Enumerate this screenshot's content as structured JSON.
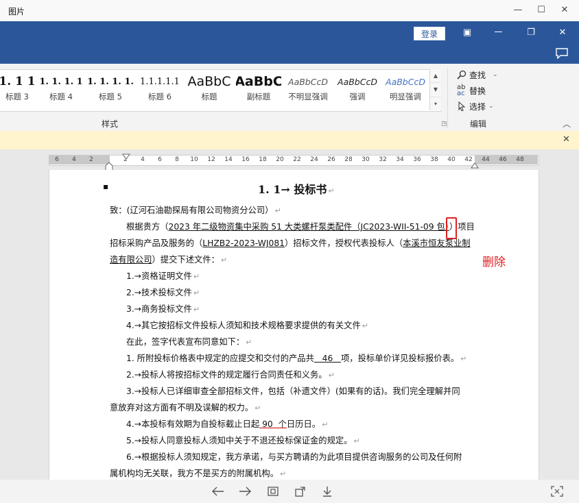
{
  "viewer": {
    "title": "图片",
    "controls": {
      "minimize": "—",
      "maximize": "☐",
      "close": "✕"
    }
  },
  "word": {
    "login": "登录",
    "window_controls": {
      "ribbon_display": "▣",
      "restore": "❐",
      "close": "✕"
    }
  },
  "ribbon": {
    "styles": [
      {
        "sample": "1. 1  1",
        "label": "标题 3"
      },
      {
        "sample": "1. 1. 1. 1",
        "label": "标题 4"
      },
      {
        "sample": "1. 1. 1. 1.",
        "label": "标题 5"
      },
      {
        "sample": "1.1.1.1.1",
        "label": "标题 6"
      },
      {
        "sample": "AaBbC",
        "label": "标题"
      },
      {
        "sample": "AaBbC",
        "label": "副标题"
      },
      {
        "sample": "AaBbCcD",
        "label": "不明显强调"
      },
      {
        "sample": "AaBbCcD",
        "label": "强调"
      },
      {
        "sample": "AaBbCcD",
        "label": "明显强调"
      }
    ],
    "styles_group_label": "样式",
    "editing": {
      "find": "查找",
      "replace": "替换",
      "select": "选择",
      "group_label": "编辑"
    }
  },
  "ruler": {
    "ticks": [
      "6",
      "4",
      "2",
      "",
      "2",
      "4",
      "6",
      "8",
      "10",
      "12",
      "14",
      "16",
      "18",
      "20",
      "22",
      "24",
      "26",
      "28",
      "30",
      "32",
      "34",
      "36",
      "38",
      "40",
      "42",
      "44",
      "46",
      "48"
    ]
  },
  "document": {
    "title": "1. 1→ 投标书",
    "to_line": "致：(辽河石油勘探局有限公司物资分公司）",
    "p1_a": "根据贵方（",
    "p1_project": "2023 年二级物资集中采购 51 大类螺杆泵类配件（JC2023-WII-51-09 包）",
    "p1_b": "）项目",
    "p2_a": "招标采购产品及服务的（",
    "p2_code": "LHZB2-2023-WJ081",
    "p2_b": "）招标文件，授权代表投标人（",
    "p2_company": "本溪市恒友泵业制",
    "p3_company": "造有限公司",
    "p3_b": "）提交下述文件：",
    "list_docs": [
      "1.→资格证明文件",
      "2.→技术投标文件",
      "3.→商务投标文件",
      "4.→其它按招标文件投标人须知和技术规格要求提供的有关文件"
    ],
    "declare": "在此，签字代表宣布同意如下：",
    "item1_a": "1. 所附投标价格表中规定的应提交和交付的产品共",
    "item1_num": "   46   ",
    "item1_b": "项，投标单价详见投标报价表。",
    "item2": "2.→投标人将按招标文件的规定履行合同责任和义务。",
    "item3_a": "3.→投标人已详细审查全部招标文件，包括（补遗文件）(如果有的话)。我们完全理解并同",
    "item3_b": "意放弃对这方面有不明及误解的权力。",
    "item4_a": "4.→本投标有效期为自投标截止日起",
    "item4_num": " 90  个",
    "item4_b": "日历日。",
    "item5": "5.→投标人同意投标人须知中关于不退还投标保证金的规定。",
    "item6_a": "6.→根据投标人须知规定，我方承诺，与买方聘请的为此项目提供咨询服务的公司及任何附",
    "item6_b": "属机构均无关联，我方不是买方的附属机构。",
    "para_mark": "↵",
    "bullet": "▪"
  },
  "annotation": {
    "note": "删除",
    "color": "#e02020"
  },
  "bottom_toolbar": {
    "buttons": [
      "←",
      "→",
      "⊡",
      "⤴",
      "⤓",
      "⛶"
    ]
  }
}
